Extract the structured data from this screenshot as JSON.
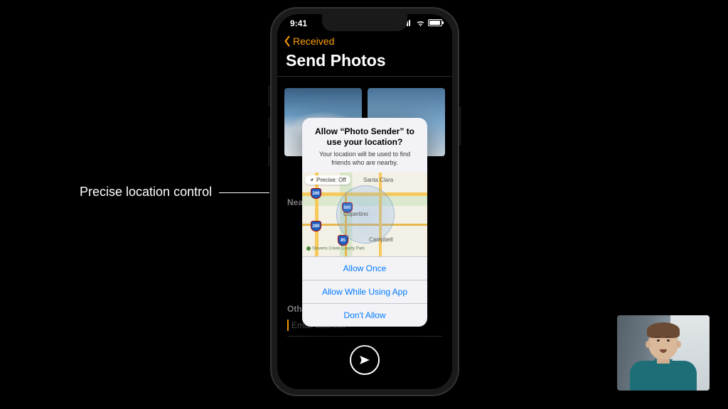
{
  "annotation": {
    "label": "Precise location control"
  },
  "status": {
    "time": "9:41"
  },
  "nav": {
    "back_label": "Received",
    "title": "Send Photos"
  },
  "sections": {
    "nearby_label": "Nearby",
    "other_label": "Other",
    "email_placeholder": "Email address"
  },
  "alert": {
    "title": "Allow “Photo Sender” to use your location?",
    "message": "Your location will be used to find friends who are nearby.",
    "precise_label": "Precise: Off",
    "cities": {
      "santa_clara": "Santa Clara",
      "cupertino": "Cupertino",
      "campbell": "Campbell"
    },
    "park": "Stevens Creek County Park",
    "highways": {
      "h280": "280",
      "h880": "880",
      "h85": "85"
    },
    "buttons": {
      "allow_once": "Allow Once",
      "allow_while": "Allow While Using App",
      "dont_allow": "Don't Allow"
    }
  }
}
